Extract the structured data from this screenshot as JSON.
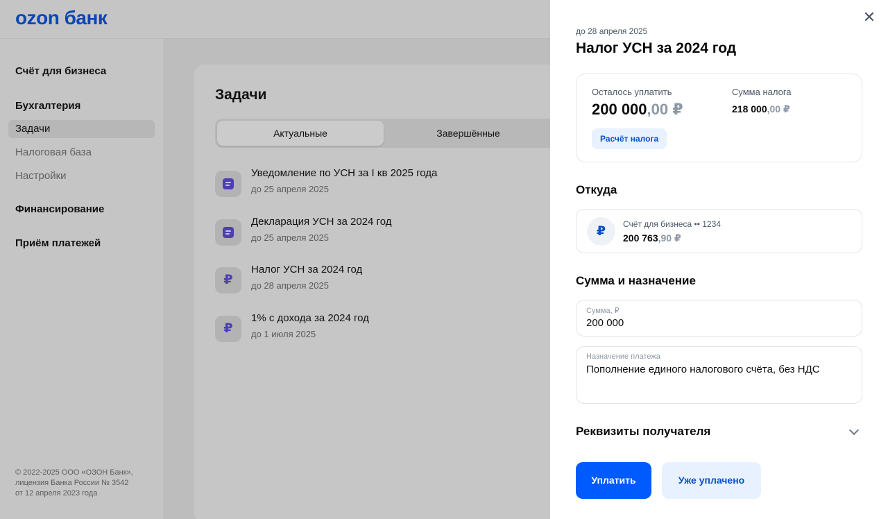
{
  "app": {
    "logo": "ozon банк"
  },
  "sidebar": {
    "sections": [
      {
        "label": "Счёт для бизнеса"
      },
      {
        "label": "Бухгалтерия"
      },
      {
        "label": "Финансирование"
      },
      {
        "label": "Приём платежей"
      }
    ],
    "items": [
      {
        "label": "Задачи",
        "active": true
      },
      {
        "label": "Налоговая база",
        "active": false
      },
      {
        "label": "Настройки",
        "active": false
      }
    ],
    "copyright": {
      "line1": "© 2022-2025 ООО «ОЗОН Банк»,",
      "line2": "лицензия Банка России № 3542",
      "line3": "от 12 апреля 2023 года"
    }
  },
  "tasks_page": {
    "title": "Задачи",
    "tabs": [
      {
        "label": "Актуальные",
        "active": true
      },
      {
        "label": "Завершённые",
        "active": false
      }
    ],
    "tasks": [
      {
        "icon": "document-icon",
        "title": "Уведомление по УСН за I кв 2025 года",
        "due": "до 25 апреля 2025"
      },
      {
        "icon": "document-icon",
        "title": "Декларация УСН за 2024 год",
        "due": "до 25 апреля 2025"
      },
      {
        "icon": "ruble-icon",
        "title": "Налог УСН за 2024 год",
        "due": "до 28 апреля 2025"
      },
      {
        "icon": "ruble-icon",
        "title": "1% с дохода за 2024 год",
        "due": "до 1 июля 2025"
      }
    ]
  },
  "drawer": {
    "close_glyph": "✕",
    "due": "до 28 апреля 2025",
    "title": "Налог УСН за 2024 год",
    "summary": {
      "remaining_label": "Осталось уплатить",
      "remaining_int": "200 000",
      "remaining_frac": ",00 ₽",
      "tax_label": "Сумма налога",
      "tax_int": "218 000",
      "tax_frac": ",00 ₽",
      "calc_button": "Расчёт налога"
    },
    "from": {
      "heading": "Откуда",
      "account_icon": "₽",
      "account_name": "Счёт для бизнеса •• 1234",
      "balance_int": "200 763",
      "balance_frac": ",90 ₽"
    },
    "amount_section": {
      "heading": "Сумма и назначение",
      "amount_label": "Сумма, ₽",
      "amount_value": "200 000",
      "purpose_label": "Назначение платежа",
      "purpose_value": "Пополнение единого налогового счёта, без НДС"
    },
    "recipient": {
      "heading": "Реквизиты получателя"
    },
    "actions": {
      "pay": "Уплатить",
      "already_paid": "Уже уплачено"
    }
  },
  "colors": {
    "brand_blue": "#005bff",
    "logo_blue": "#0b46b8",
    "accent_purple": "#4d3fb0",
    "light_blue_bg": "#e8f1ff",
    "overlay_gray": "#c4c4c4"
  }
}
